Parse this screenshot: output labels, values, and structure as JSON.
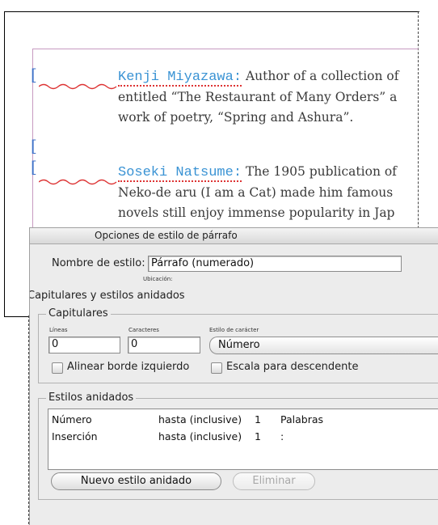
{
  "document": {
    "entries": [
      {
        "name": "Kenji Miyazawa:",
        "lines": [
          "Author of a collection of",
          "entitled “The Restaurant of Many Orders” a",
          "work of poetry, “Spring and Ashura”."
        ]
      },
      {
        "name": "Soseki Natsume:",
        "lines": [
          "The 1905 publication of",
          "Neko-de aru (I am a Cat) made him famous",
          "novels still enjoy immense popularity in Jap"
        ]
      }
    ]
  },
  "dialog": {
    "title": "Opciones de estilo de párrafo",
    "style_name_label": "Nombre de estilo:",
    "style_name_value": "Párrafo (numerado)",
    "location_label": "Ubicación:",
    "section_title": "Capitulares y estilos anidados",
    "drop_caps": {
      "title": "Capitulares",
      "lines_label": "Líneas",
      "lines_value": "0",
      "characters_label": "Caracteres",
      "characters_value": "0",
      "char_style_label": "Estilo de carácter",
      "char_style_value": "Número",
      "align_left_label": "Alinear borde izquierdo",
      "scale_descender_label": "Escala para descendente"
    },
    "nested_styles": {
      "title": "Estilos anidados",
      "rows": [
        {
          "style": "Número",
          "mode": "hasta (inclusive)",
          "count": "1",
          "unit": "Palabras"
        },
        {
          "style": "Inserción",
          "mode": "hasta (inclusive)",
          "count": "1",
          "unit": ":"
        }
      ],
      "new_button": "Nuevo estilo anidado",
      "delete_button": "Eliminar"
    }
  }
}
